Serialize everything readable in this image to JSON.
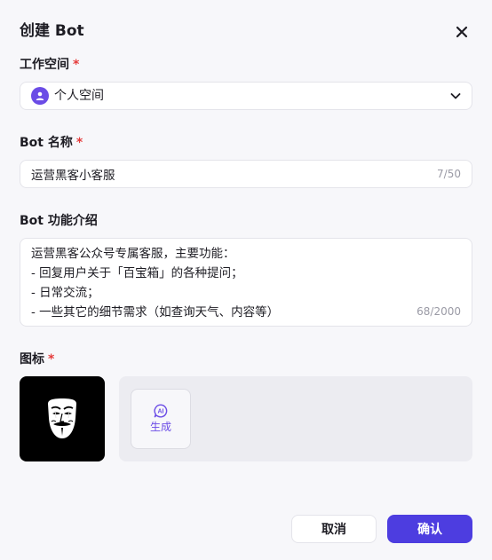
{
  "dialog": {
    "title": "创建 Bot",
    "close_icon": "close-icon"
  },
  "workspace": {
    "label": "工作空间",
    "required_mark": "*",
    "value": "个人空间",
    "avatar_icon": "user-icon",
    "dropdown_icon": "chevron-down-icon"
  },
  "bot_name": {
    "label": "Bot 名称",
    "required_mark": "*",
    "value": "运营黑客小客服",
    "counter": "7/50"
  },
  "bot_desc": {
    "label": "Bot 功能介绍",
    "text": "运营黑客公众号专属客服，主要功能：\n- 回复用户关于「百宝箱」的各种提问；\n- 日常交流；\n- 一些其它的细节需求（如查询天气、内容等）",
    "counter": "68/2000"
  },
  "icon_section": {
    "label": "图标",
    "required_mark": "*",
    "preview_icon": "anonymous-mask-icon",
    "generate_label": "生成",
    "generate_icon": "ai-icon"
  },
  "footer": {
    "cancel_label": "取消",
    "confirm_label": "确认"
  },
  "colors": {
    "accent": "#4d3de0",
    "required": "#e53b3b",
    "background": "#f7f7fa"
  }
}
